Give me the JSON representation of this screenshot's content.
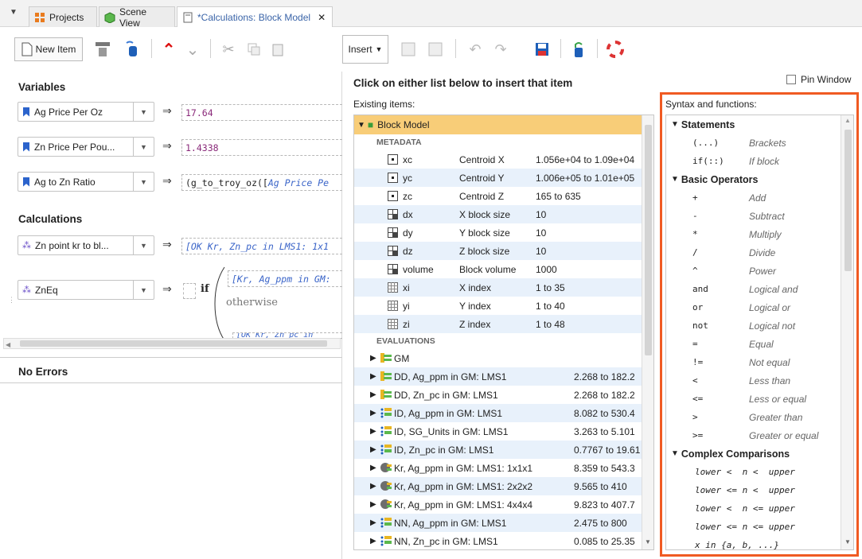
{
  "tabs": [
    {
      "label": "Projects"
    },
    {
      "label": "Scene View"
    },
    {
      "label": "*Calculations: Block Model"
    }
  ],
  "toolbar": {
    "new_item": "New Item",
    "insert": "Insert"
  },
  "left": {
    "variables_title": "Variables",
    "variables": [
      {
        "name": "Ag Price Per Oz",
        "value": "17.64"
      },
      {
        "name": "Zn Price Per Pou...",
        "value": "1.4338"
      },
      {
        "name": "Ag to Zn Ratio",
        "value_prefix": "(g_to_troy_oz([",
        "value_italic": "Ag Price Pe"
      }
    ],
    "calculations_title": "Calculations",
    "calculations": [
      {
        "name": "Zn point kr to bl...",
        "value": "[OK Kr, Zn_pc in LMS1: 1x1"
      },
      {
        "name": "ZnEq",
        "if_kw": "if",
        "if_value": "[Kr, Ag_ppm in GM:",
        "otherwise": "otherwise",
        "tail_value": "[OK Kr, Zn_pc in"
      }
    ],
    "errors_title": "No Errors"
  },
  "popup": {
    "heading": "Click on either list below to insert that item",
    "pin_label": "Pin Window",
    "existing_label": "Existing items:",
    "syntax_label": "Syntax and functions:",
    "root": "Block Model",
    "metadata_label": "METADATA",
    "metadata": [
      {
        "name": "xc",
        "desc": "Centroid X",
        "range": "1.056e+04 to 1.09e+04",
        "icon": "point-icon"
      },
      {
        "name": "yc",
        "desc": "Centroid Y",
        "range": "1.006e+05 to 1.01e+05",
        "icon": "point-icon"
      },
      {
        "name": "zc",
        "desc": "Centroid Z",
        "range": "165 to 635",
        "icon": "point-icon"
      },
      {
        "name": "dx",
        "desc": "X block size",
        "range": "10",
        "icon": "block-icon"
      },
      {
        "name": "dy",
        "desc": "Y block size",
        "range": "10",
        "icon": "block-icon"
      },
      {
        "name": "dz",
        "desc": "Z block size",
        "range": "10",
        "icon": "block-icon"
      },
      {
        "name": "volume",
        "desc": "Block volume",
        "range": "1000",
        "icon": "block-icon"
      },
      {
        "name": "xi",
        "desc": "X index",
        "range": "1 to 35",
        "icon": "grid-icon"
      },
      {
        "name": "yi",
        "desc": "Y index",
        "range": "1 to 40",
        "icon": "grid-icon"
      },
      {
        "name": "zi",
        "desc": "Z index",
        "range": "1 to 48",
        "icon": "grid-icon"
      }
    ],
    "evaluations_label": "EVALUATIONS",
    "evaluations": [
      {
        "name": "GM",
        "range": "",
        "icon": "geomodel-icon"
      },
      {
        "name": "DD, Ag_ppm in GM: LMS1",
        "range": "2.268 to 182.2",
        "icon": "geomodel-icon"
      },
      {
        "name": "DD, Zn_pc in GM: LMS1",
        "range": "2.268 to 182.2",
        "icon": "geomodel-icon"
      },
      {
        "name": "ID, Ag_ppm in GM: LMS1",
        "range": "8.082 to 530.4",
        "icon": "idw-icon"
      },
      {
        "name": "ID, SG_Units in GM: LMS1",
        "range": "3.263 to 5.101",
        "icon": "idw-icon"
      },
      {
        "name": "ID, Zn_pc in GM: LMS1",
        "range": "0.7767 to 19.61",
        "icon": "idw-icon"
      },
      {
        "name": "Kr, Ag_ppm in GM: LMS1: 1x1x1",
        "range": "8.359 to 543.3",
        "icon": "kriging-icon"
      },
      {
        "name": "Kr, Ag_ppm in GM: LMS1: 2x2x2",
        "range": "9.565 to 410",
        "icon": "kriging-icon"
      },
      {
        "name": "Kr, Ag_ppm in GM: LMS1: 4x4x4",
        "range": "9.823 to 407.7",
        "icon": "kriging-icon"
      },
      {
        "name": "NN, Ag_ppm in GM: LMS1",
        "range": "2.475 to 800",
        "icon": "idw-icon"
      },
      {
        "name": "NN, Zn_pc in GM: LMS1",
        "range": "0.085 to 25.35",
        "icon": "idw-icon"
      }
    ],
    "syntax": {
      "statements_title": "Statements",
      "statements": [
        {
          "k": "(...)",
          "d": "Brackets"
        },
        {
          "k": "if(::)",
          "d": "If block"
        }
      ],
      "operators_title": "Basic Operators",
      "operators": [
        {
          "k": "+",
          "d": "Add"
        },
        {
          "k": "-",
          "d": "Subtract"
        },
        {
          "k": "*",
          "d": "Multiply"
        },
        {
          "k": "/",
          "d": "Divide"
        },
        {
          "k": "^",
          "d": "Power"
        },
        {
          "k": "and",
          "d": "Logical and"
        },
        {
          "k": "or",
          "d": "Logical or"
        },
        {
          "k": "not",
          "d": "Logical not"
        },
        {
          "k": "=",
          "d": "Equal"
        },
        {
          "k": "!=",
          "d": "Not equal"
        },
        {
          "k": "<",
          "d": "Less than"
        },
        {
          "k": "<=",
          "d": "Less or equal"
        },
        {
          "k": ">",
          "d": "Greater than"
        },
        {
          "k": ">=",
          "d": "Greater or equal"
        }
      ],
      "complex_title": "Complex Comparisons",
      "complex": [
        "lower <  n <  upper",
        "lower <= n <  upper",
        "lower <  n <= upper",
        "lower <= n <= upper",
        "x in {a, b, ...}"
      ]
    }
  },
  "colors": {
    "highlight_border": "#f05a22",
    "root_row": "#f8cd78",
    "alt_row": "#e8f1fb"
  }
}
